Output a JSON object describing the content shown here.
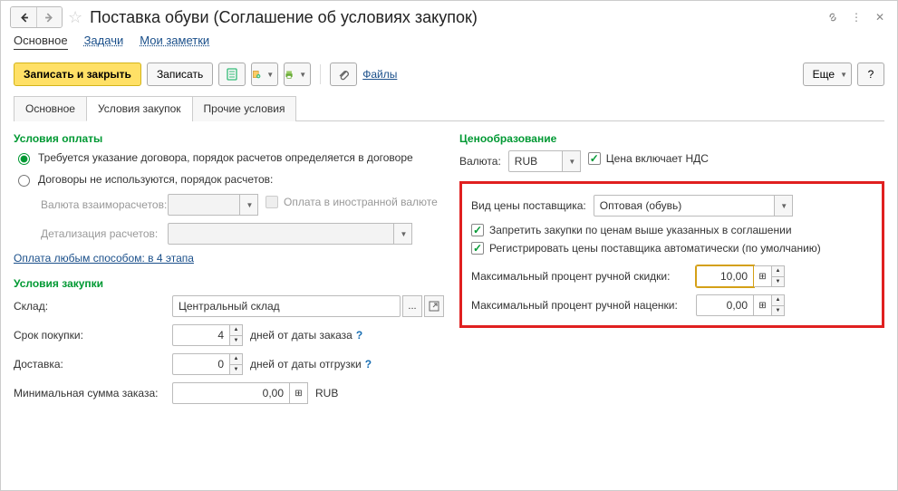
{
  "title": "Поставка обуви (Соглашение об условиях закупок)",
  "sections": {
    "main": "Основное",
    "tasks": "Задачи",
    "notes": "Мои заметки"
  },
  "toolbar": {
    "save_close": "Записать и закрыть",
    "save": "Записать",
    "files": "Файлы",
    "more": "Еще",
    "help": "?"
  },
  "tabs": {
    "main": "Основное",
    "purchase": "Условия закупок",
    "other": "Прочие условия"
  },
  "left": {
    "payment_title": "Условия оплаты",
    "radio_contract": "Требуется указание договора, порядок расчетов определяется в договоре",
    "radio_nocontract": "Договоры не используются, порядок расчетов:",
    "currency_label": "Валюта взаиморасчетов:",
    "foreign_pay": "Оплата в иностранной валюте",
    "detail_label": "Детализация расчетов:",
    "payment_link": "Оплата любым способом: в 4 этапа",
    "purchase_title": "Условия закупки",
    "warehouse_label": "Склад:",
    "warehouse_value": "Центральный склад",
    "dots": "...",
    "term_label": "Срок покупки:",
    "term_value": "4",
    "term_after": "дней от даты заказа",
    "delivery_label": "Доставка:",
    "delivery_value": "0",
    "delivery_after": "дней от даты отгрузки",
    "min_sum_label": "Минимальная сумма заказа:",
    "min_sum_value": "0,00",
    "min_sum_currency": "RUB"
  },
  "right": {
    "pricing_title": "Ценообразование",
    "currency_label": "Валюта:",
    "currency_value": "RUB",
    "price_includes_vat": "Цена включает НДС",
    "vendor_price_type_label": "Вид цены поставщика:",
    "vendor_price_type_value": "Оптовая (обувь)",
    "forbid_above": "Запретить закупки по ценам выше указанных в соглашении",
    "auto_register": "Регистрировать цены поставщика автоматически (по умолчанию)",
    "max_discount_label": "Максимальный процент ручной скидки:",
    "max_discount_value": "10,00",
    "max_markup_label": "Максимальный процент ручной наценки:",
    "max_markup_value": "0,00"
  }
}
